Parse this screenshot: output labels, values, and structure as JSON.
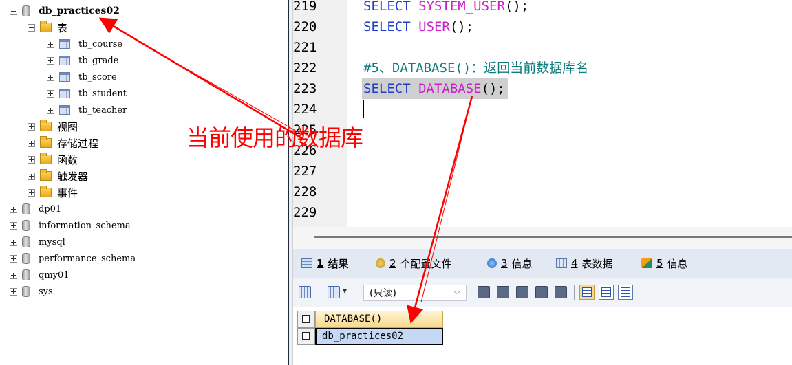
{
  "tree": {
    "db_current": "db_practices02",
    "folder_tables": "表",
    "tables": [
      "tb_course",
      "tb_grade",
      "tb_score",
      "tb_student",
      "tb_teacher"
    ],
    "folders": [
      "视图",
      "存储过程",
      "函数",
      "触发器",
      "事件"
    ],
    "databases": [
      "dp01",
      "information_schema",
      "mysql",
      "performance_schema",
      "qmy01",
      "sys"
    ]
  },
  "editor": {
    "line_numbers": [
      "219",
      "220",
      "221",
      "222",
      "223",
      "224",
      "225",
      "226",
      "227",
      "228",
      "229"
    ],
    "line219": {
      "kw": "SELECT",
      "fn": "SYSTEM_USER",
      "rest": "();"
    },
    "line220": {
      "kw": "SELECT",
      "fn": "USER",
      "rest": "();"
    },
    "line222": {
      "comment": "#5、DATABASE()：",
      "comment_cjk": "返回当前数据库名"
    },
    "line223": {
      "kw": "SELECT",
      "fn": "DATABASE",
      "rest": "();"
    }
  },
  "tabs": [
    {
      "num": "1",
      "label": "结果",
      "icon": "result-grid-icon"
    },
    {
      "num": "2",
      "label": "个配置文件",
      "icon": "profile-icon"
    },
    {
      "num": "3",
      "label": "信息",
      "icon": "info-icon"
    },
    {
      "num": "4",
      "label": "表数据",
      "icon": "table-data-icon"
    },
    {
      "num": "5",
      "label": "信息",
      "icon": "info-flag-icon"
    }
  ],
  "toolbar": {
    "readonly_label": "(只读)"
  },
  "grid": {
    "column": "DATABASE()",
    "value": "db_practices02"
  },
  "annotation": {
    "label": "当前使用的数据库",
    "color": "#ff0000"
  }
}
